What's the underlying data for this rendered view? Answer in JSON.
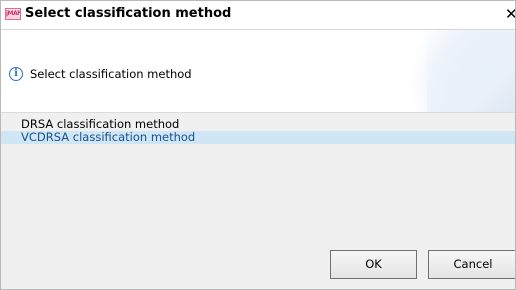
{
  "window": {
    "title": "Select classification method",
    "app_icon_text": "jMAF",
    "close_glyph": "✕"
  },
  "header": {
    "info_glyph": "i",
    "message": "Select classification method"
  },
  "list": {
    "items": [
      {
        "label": "DRSA classification method",
        "selected": false
      },
      {
        "label": "VCDRSA classification method",
        "selected": true
      }
    ]
  },
  "buttons": {
    "ok_label": "OK",
    "cancel_label": "Cancel"
  },
  "colors": {
    "selection_bg": "#cfe6f5",
    "selection_text": "#1a4f8f",
    "info_icon": "#2f6fc2"
  }
}
